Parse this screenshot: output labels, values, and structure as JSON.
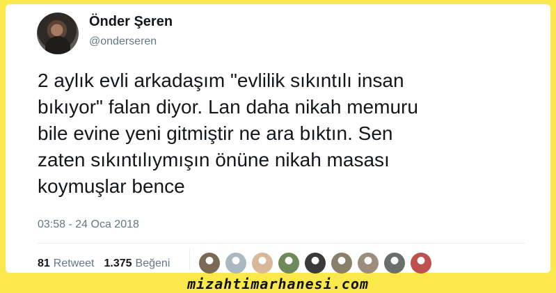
{
  "user": {
    "display_name": "Önder Şeren",
    "handle": "@onderseren"
  },
  "tweet": {
    "text": "2 aylık evli arkadaşım \"evlilik sıkıntılı insan\nbıkıyor\" falan diyor. Lan daha nikah memuru\nbile evine yeni gitmiştir ne ara bıktın. Sen\nzaten sıkıntılıymışın önüne nikah masası\nkoymuşlar bence",
    "timestamp": "03:58 - 24 Oca 2018"
  },
  "stats": {
    "retweet_count": "81",
    "retweet_label": "Retweet",
    "like_count": "1.375",
    "like_label": "Beğeni"
  },
  "likers": [
    {
      "name": "liker-avatar-1",
      "color": "#7a6a55"
    },
    {
      "name": "liker-avatar-2",
      "color": "#aab8c2"
    },
    {
      "name": "liker-avatar-3",
      "color": "#d9b89a"
    },
    {
      "name": "liker-avatar-4",
      "color": "#6f8a5a"
    },
    {
      "name": "liker-avatar-5",
      "color": "#3a3a3a"
    },
    {
      "name": "liker-avatar-6",
      "color": "#8a7f6a"
    },
    {
      "name": "liker-avatar-7",
      "color": "#9c8d7d"
    },
    {
      "name": "liker-avatar-8",
      "color": "#6b6f6b"
    },
    {
      "name": "liker-avatar-9",
      "color": "#c0504d"
    }
  ],
  "watermark": "mizahtimarhanesi.com",
  "colors": {
    "background": "#fbe94b",
    "card": "#ffffff",
    "text": "#14171a",
    "muted": "#657786"
  }
}
